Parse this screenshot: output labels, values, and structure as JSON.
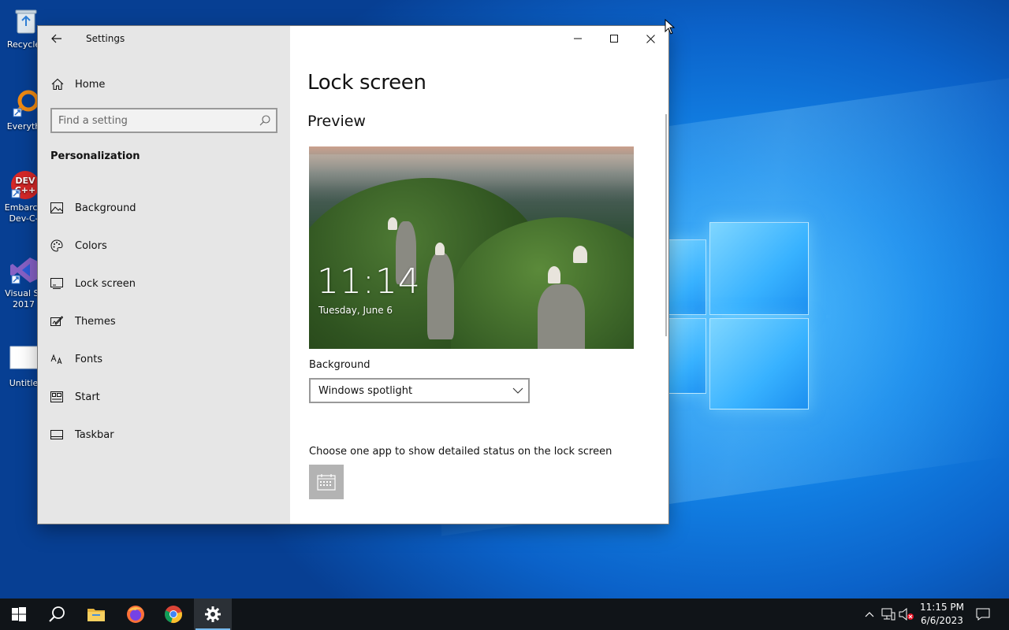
{
  "desktop": {
    "icons": [
      {
        "label": "Recycle"
      },
      {
        "label": "Everyth"
      },
      {
        "label": "Embarca",
        "label2": "Dev-C-"
      },
      {
        "label": "Visual St",
        "label2": "2017"
      },
      {
        "label": "Untitle"
      }
    ]
  },
  "window": {
    "title": "Settings",
    "sidebar": {
      "home_label": "Home",
      "search_placeholder": "Find a setting",
      "section_heading": "Personalization",
      "items": [
        {
          "label": "Background",
          "icon": "image-icon"
        },
        {
          "label": "Colors",
          "icon": "palette-icon"
        },
        {
          "label": "Lock screen",
          "icon": "lock-screen-icon"
        },
        {
          "label": "Themes",
          "icon": "themes-icon"
        },
        {
          "label": "Fonts",
          "icon": "fonts-icon"
        },
        {
          "label": "Start",
          "icon": "start-icon"
        },
        {
          "label": "Taskbar",
          "icon": "taskbar-icon"
        }
      ]
    },
    "content": {
      "page_title": "Lock screen",
      "preview_heading": "Preview",
      "preview_time": "11:14",
      "preview_date": "Tuesday, June 6",
      "background_label": "Background",
      "background_value": "Windows spotlight",
      "status_label": "Choose one app to show detailed status on the lock screen"
    }
  },
  "taskbar": {
    "apps": [
      "start-icon",
      "search-icon",
      "file-explorer-icon",
      "firefox-icon",
      "chrome-icon",
      "settings-icon"
    ],
    "clock_time": "11:15 PM",
    "clock_date": "6/6/2023"
  },
  "colors": {
    "accent": "#76b9ed",
    "sidebar_bg": "#e6e6e6",
    "taskbar_bg": "#101418"
  }
}
